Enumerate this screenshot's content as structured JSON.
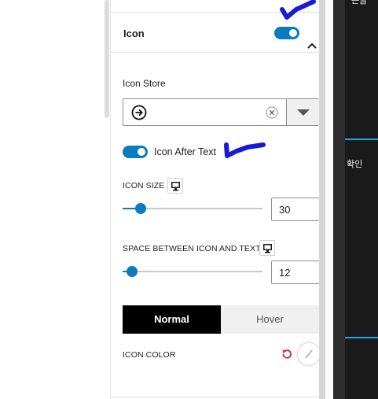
{
  "section": {
    "title": "Icon",
    "toggle_on": true
  },
  "icon_store": {
    "label": "Icon Store",
    "selected_icon": "arrow-right-circle-icon"
  },
  "icon_after_text": {
    "label": "Icon After Text",
    "toggle_on": true
  },
  "icon_size": {
    "label": "ICON SIZE",
    "value": "30",
    "slider_fraction": 0.13
  },
  "space_between": {
    "label": "SPACE BETWEEN ICON AND TEXT",
    "value": "12",
    "slider_fraction": 0.07
  },
  "state_tabs": {
    "normal": "Normal",
    "hover": "Hover",
    "active": "normal"
  },
  "icon_color": {
    "label": "ICON COLOR"
  },
  "right_panel": {
    "text_top": "는글",
    "text_mid": "확인"
  },
  "colors": {
    "accent": "#0a7bbf",
    "annotation": "#1a1ad6",
    "reset": "#d63638",
    "highlight_line": "#1fa3e3"
  }
}
